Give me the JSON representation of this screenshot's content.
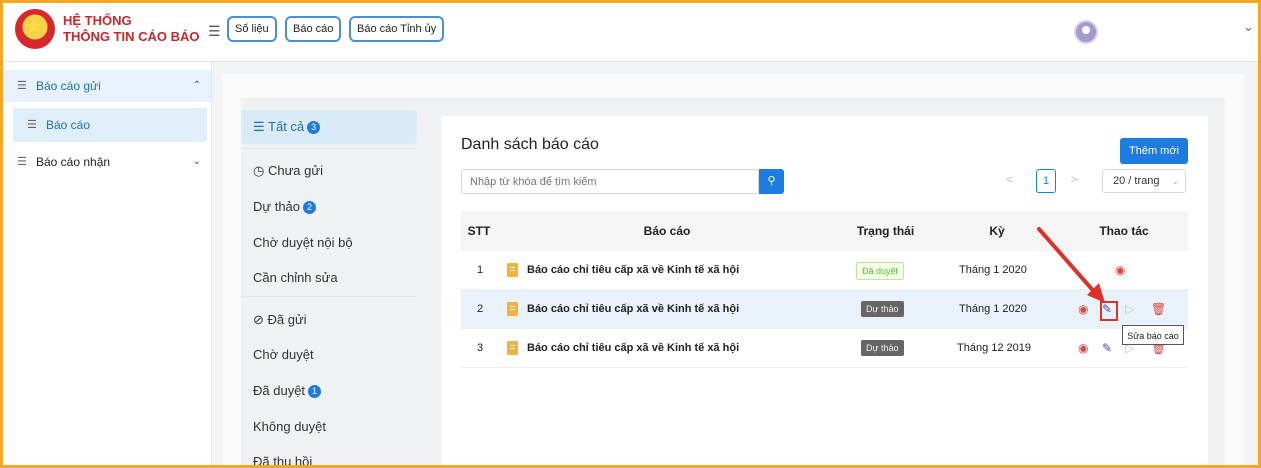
{
  "header": {
    "brand_line1": "HỆ THỐNG",
    "brand_line2": "THÔNG TIN CÁO BÁO",
    "nav_buttons": [
      "Số liệu",
      "Báo cáo",
      "Báo cáo Tỉnh ủy"
    ]
  },
  "sidebar": {
    "sent_group": "Báo cáo gửi",
    "sent_item": "Báo cáo",
    "received_group": "Báo cáo nhận"
  },
  "filters": {
    "all": "Tất cả",
    "all_count": "3",
    "unsent": "Chưa gửi",
    "draft": "Dự thảo",
    "draft_count": "2",
    "pending_internal": "Chờ duyệt nội bộ",
    "needs_edit": "Cần chỉnh sửa",
    "sent": "Đã gửi",
    "pending": "Chờ duyệt",
    "approved": "Đã duyệt",
    "approved_count": "1",
    "rejected": "Không duyệt",
    "withdrawn": "Đã thu hồi"
  },
  "list": {
    "title": "Danh sách báo cáo",
    "add_button": "Thêm mới",
    "search_placeholder": "Nhập từ khóa để tìm kiếm",
    "page": "1",
    "page_size": "20 / trang",
    "columns": {
      "stt": "STT",
      "report": "Báo cáo",
      "status": "Trạng thái",
      "period": "Kỳ",
      "actions": "Thao tác"
    },
    "rows": [
      {
        "stt": "1",
        "title": "Báo cáo chỉ tiêu cấp xã về Kinh tế xã hội",
        "status": "Đã duyệt",
        "period": "Tháng 1 2020"
      },
      {
        "stt": "2",
        "title": "Báo cáo chỉ tiêu cấp xã về Kinh tế xã hội",
        "status": "Dự thảo",
        "period": "Tháng 1 2020"
      },
      {
        "stt": "3",
        "title": "Báo cáo chỉ tiêu cấp xã về Kinh tế xã hội",
        "status": "Dự thảo",
        "period": "Tháng 12 2019"
      }
    ],
    "tooltip": "Sửa báo cáo"
  },
  "colors": {
    "accent": "#1e7be0",
    "frame": "#f5a623",
    "brand": "#c8272c",
    "highlight": "#e0302a"
  }
}
